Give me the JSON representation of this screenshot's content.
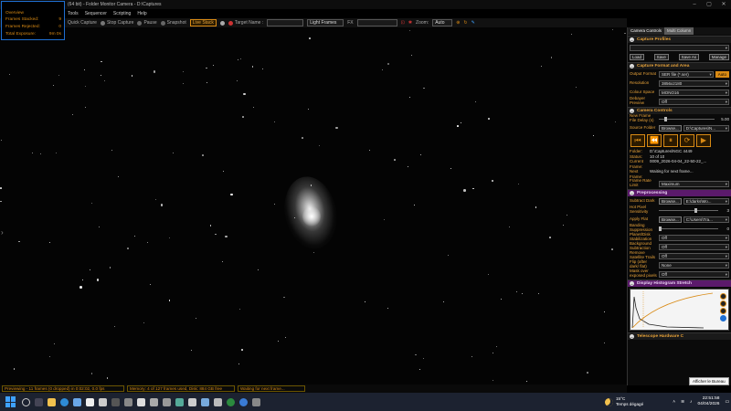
{
  "window": {
    "title": "(64 bit) - Folder Monitor Camera - D:\\Captures"
  },
  "menu": [
    "Tools",
    "Sequencer",
    "Scripting",
    "Help"
  ],
  "toolbar": {
    "quick_capture": "Quick Capture",
    "stop_capture": "Stop Capture",
    "pause": "Pause",
    "snapshot": "Snapshot",
    "live_stack": "Live Stack",
    "target_name_label": "Target Name :",
    "light_frames": "Light Frames",
    "fx_label": "FX",
    "zoom_label": "Zoom:",
    "zoom_value": "Auto"
  },
  "overview": {
    "title": "Overview",
    "rows": [
      {
        "label": "Frames Stacked:",
        "value": "9"
      },
      {
        "label": "Frames Rejected:",
        "value": "0"
      },
      {
        "label": "Total Exposure:",
        "value": "9m 0s"
      }
    ]
  },
  "statusbar": {
    "previewing": "Previewing - 11 frames (0 dropped) in 0:02:02, 0.0 fps",
    "memory": "Memory: 4 of 127 frames used, Disk: 884 GB free",
    "waiting": "Waiting for next frame..."
  },
  "panel": {
    "tabs": [
      "Camera Controls",
      "Multi Column"
    ],
    "capture_profiles": {
      "title": "Capture Profiles",
      "buttons": [
        "Load",
        "Save",
        "Save As",
        "Manage"
      ]
    },
    "capture_format": {
      "title": "Capture Format and Area",
      "output_format_label": "Output Format",
      "output_format_value": "SER file (*.ser)",
      "auto_label": "Auto",
      "resolution_label": "Resolution",
      "resolution_value": "3856x2180",
      "colour_space_label": "Colour Space",
      "colour_space_value": "MONO16",
      "debayer_label": "Debayer Preview",
      "debayer_value": "Off"
    },
    "camera_controls": {
      "title": "Camera Controls",
      "new_frame_label": "New Frame File Delay (s)",
      "new_frame_value": "5.00",
      "new_frame_fraction": 0.1,
      "source_folder_label": "Source Folder",
      "browse_label": "Browse...",
      "source_folder_value": "D:\\Captures\\N...",
      "transport": [
        "⏮",
        "⏪",
        "⏸",
        "⟳",
        "▶"
      ],
      "info": [
        {
          "k": "Folder:",
          "v": "D:\\Captures\\NGC 4449"
        },
        {
          "k": "Status:",
          "v": "10 of 10"
        },
        {
          "k": "Current Frame:",
          "v": "0009_2026-04-04_22-50-22_..."
        },
        {
          "k": "Next Frame:",
          "v": "Waiting for next frame..."
        }
      ],
      "frame_rate_label": "Frame Rate Limit",
      "frame_rate_value": "Maximum"
    },
    "preprocessing": {
      "title": "Preprocessing",
      "subtract_dark_label": "Subtract Dark",
      "subtract_dark_browse": "Browse...",
      "subtract_dark_value": "E:\\darks\\Mo...",
      "hot_pixel_label": "Hot Pixel Sensitivity",
      "hot_pixel_value": "3",
      "hot_pixel_fraction": 0.6,
      "apply_flat_label": "Apply Flat",
      "apply_flat_browse": "Browse...",
      "apply_flat_value": "C:\\Users\\Tra...",
      "banding_label": "Banding Suppression",
      "banding_value": "0",
      "banding_fraction": 0.0,
      "flatten_label": "Planet/Disk Stabilization",
      "flatten_value": "Off",
      "bg_sub_label": "Background Subtraction",
      "bg_sub_value": "Off",
      "remove_sat_label": "Remove Satellite Trails",
      "remove_sat_value": "Off",
      "flip_label": "Flip (after dark/ flat)",
      "flip_value": "None",
      "mask_label": "Mask over exposed pixels",
      "mask_value": "Off"
    },
    "histogram": {
      "title": "Display Histogram Stretch"
    },
    "telescope": {
      "title": "Telescope Hardware C"
    }
  },
  "tooltip": "Afficher le Bureau",
  "taskbar": {
    "weather_temp": "15°C",
    "weather_desc": "Temps dégagé",
    "time": "22:51:58",
    "date": "04/04/2026"
  },
  "colors": {
    "accent": "#d98a14",
    "panel_purple": "#5b1a6b",
    "overview_border": "#1f6fd1"
  }
}
